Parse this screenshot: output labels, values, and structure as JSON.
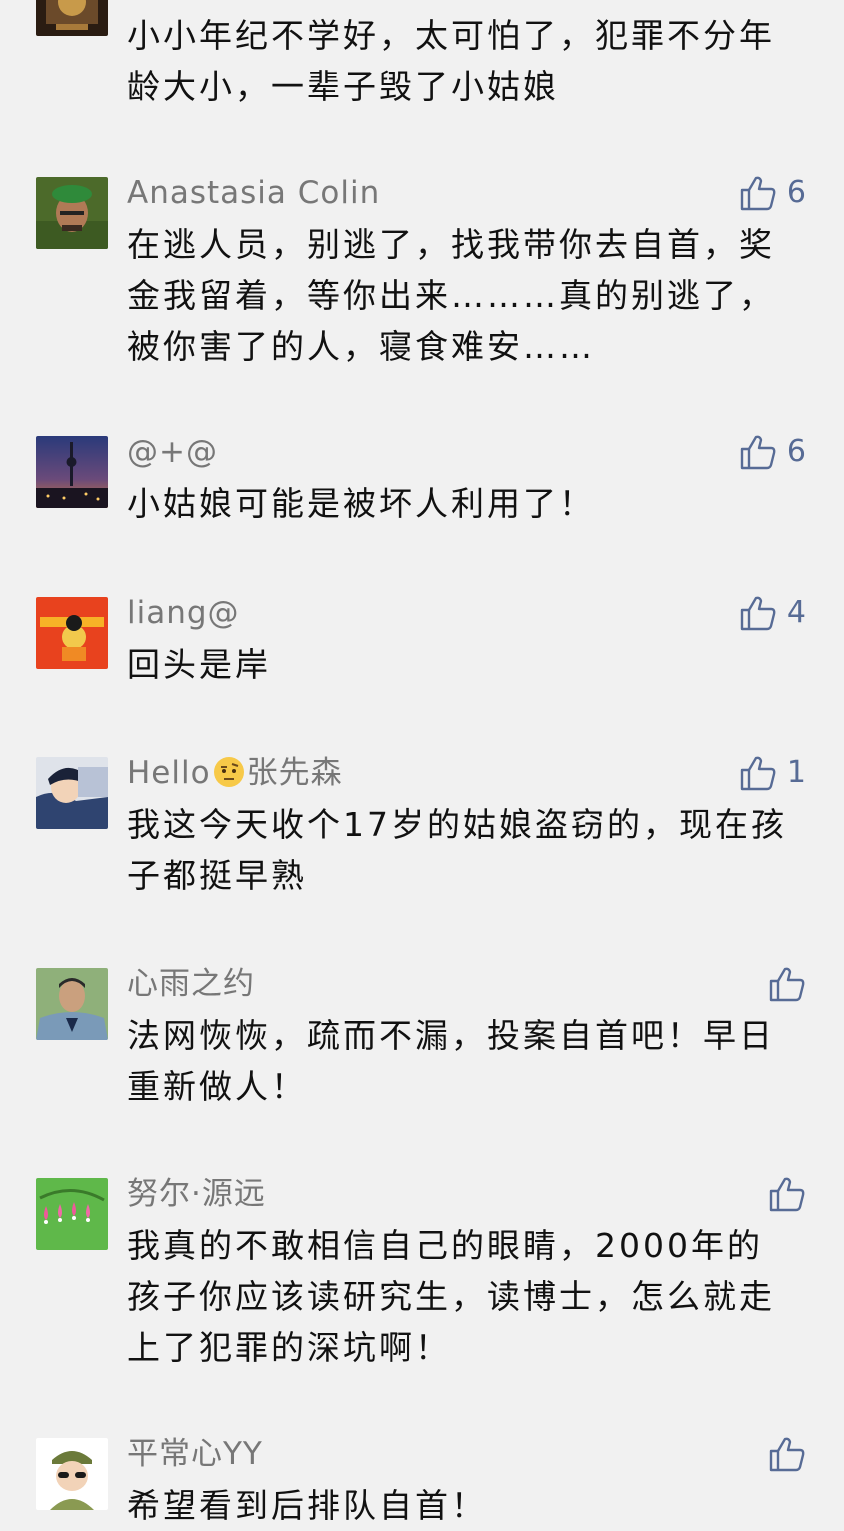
{
  "comments": [
    {
      "avatar": "temple-avatar",
      "name": "",
      "text": "小小年纪不学好，太可怕了，犯罪不分年龄大小，一辈子毁了小姑娘",
      "likes": ""
    },
    {
      "avatar": "man-green-hat-avatar",
      "name": "Anastasia Colin",
      "text": "在逃人员，别逃了，找我带你去自首，奖金我留着，等你出来………真的别逃了，被你害了的人，寝食难安……",
      "likes": "6"
    },
    {
      "avatar": "city-tower-avatar",
      "name": "@+@",
      "text": "小姑娘可能是被坏人利用了！",
      "likes": "6"
    },
    {
      "avatar": "dragon-ball-avatar",
      "name": "liang@",
      "text": "回头是岸",
      "likes": "4"
    },
    {
      "avatar": "police-cartoon-avatar",
      "name": "Hello",
      "name_emoji": "raised-eyebrow-emoji",
      "name_suffix": "张先森",
      "text": "我这今天收个17岁的姑娘盗窃的，现在孩子都挺早熟",
      "likes": "1"
    },
    {
      "avatar": "officer-photo-avatar",
      "name": "心雨之约",
      "text": "法网恢恢，疏而不漏，投案自首吧！早日重新做人！",
      "likes": ""
    },
    {
      "avatar": "flower-avatar",
      "name": "努尔·源远",
      "text": "我真的不敢相信自己的眼睛，2000年的孩子你应该读研究生，读博士，怎么就走上了犯罪的深坑啊！",
      "likes": ""
    },
    {
      "avatar": "soldier-cartoon-avatar",
      "name": "平常心YY",
      "text": "希望看到后排队自首！",
      "likes": ""
    }
  ],
  "colors": {
    "background": "#f1f1f1",
    "name": "#777777",
    "like_icon": "#576b95"
  },
  "icons": {
    "like": "thumbs-up-icon"
  }
}
